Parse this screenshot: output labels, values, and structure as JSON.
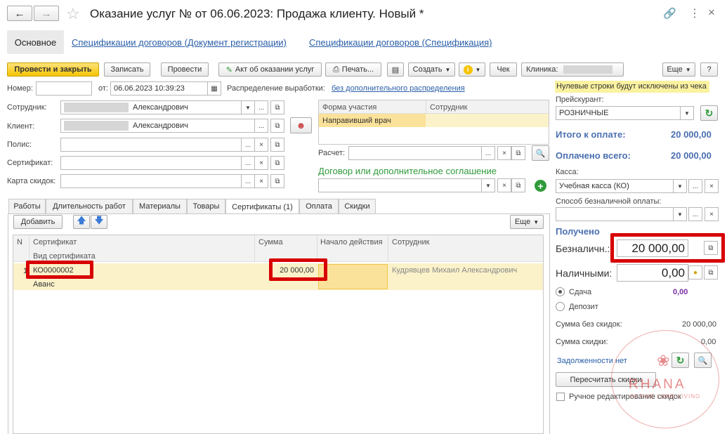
{
  "window": {
    "title": "Оказание услуг №  от 06.06.2023: Продажа клиенту.  Новый *"
  },
  "nav": {
    "main": "Основное",
    "link1": "Спецификации договоров (Документ регистрации)",
    "link2": "Спецификации договоров (Спецификация)"
  },
  "toolbar": {
    "post_close": "Провести и закрыть",
    "save": "Записать",
    "post": "Провести",
    "act": "Акт об оказании услуг",
    "print": "Печать...",
    "create": "Создать",
    "check": "Чек",
    "clinic_label": "Клиника:",
    "more": "Еще",
    "help": "?"
  },
  "form": {
    "number_label": "Номер:",
    "number_value": "",
    "from_label": "от:",
    "date_value": "06.06.2023 10:39:23",
    "distribution_label": "Распределение выработки:",
    "distribution_link": "без дополнительного распределения",
    "employee_label": "Сотрудник:",
    "employee_value": "Александрович",
    "client_label": "Клиент:",
    "client_value": "Александрович",
    "policy_label": "Полис:",
    "certificate_label": "Сертификат:",
    "discount_card_label": "Карта скидок:",
    "participation_header": "Форма участия",
    "employee_header": "Сотрудник",
    "participation_row": "Направивший врач",
    "calc_label": "Расчет:",
    "contract_label": "Договор или дополнительное соглашение"
  },
  "tabs": [
    "Работы",
    "Длительность работ",
    "Материалы",
    "Товары",
    "Сертификаты (1)",
    "Оплата",
    "Скидки"
  ],
  "table": {
    "add": "Добавить",
    "more": "Еще",
    "headers": {
      "n": "N",
      "certificate": "Сертификат",
      "certificate_type": "Вид сертификата",
      "sum": "Сумма",
      "start": "Начало действия",
      "employee": "Сотрудник"
    },
    "rows": [
      {
        "n": "1",
        "certificate": "КО0000002",
        "type": "Аванс",
        "sum": "20 000,00",
        "start": "",
        "employee": "Кудрявцев Михаил Александрович"
      }
    ]
  },
  "right": {
    "warning": "Нулевые строки будут исключены из чека",
    "pricelist_label": "Прейскурант:",
    "pricelist_value": "РОЗНИЧНЫЕ",
    "total_label": "Итого к оплате:",
    "total_value": "20 000,00",
    "paid_label": "Оплачено всего:",
    "paid_value": "20 000,00",
    "cash_desk_label": "Касса:",
    "cash_desk_value": "Учебная касса (КО)",
    "noncash_method_label": "Способ безналичной оплаты:",
    "received_label": "Получено",
    "noncash_label": "Безналичн.:",
    "noncash_value": "20 000,00",
    "cash_label": "Наличными:",
    "cash_value": "0,00",
    "change_label": "Сдача",
    "change_value": "0,00",
    "deposit_label": "Депозит",
    "sum_no_discount_label": "Сумма без скидок:",
    "sum_no_discount_value": "20 000,00",
    "discount_sum_label": "Сумма скидки:",
    "discount_sum_value": "0,00",
    "debt_link": "Задолженности нет",
    "recalc_button": "Пересчитать скидки",
    "manual_discount_label": "Ручное редактирование скидок"
  },
  "watermark": {
    "brand": "RHANA",
    "tagline": "ACTIVE LONG LIVING"
  },
  "colors": {
    "accent_yellow": "#f5c400",
    "blue": "#4a6fb0",
    "red_box": "#d80000",
    "green": "#2f9a3a"
  }
}
